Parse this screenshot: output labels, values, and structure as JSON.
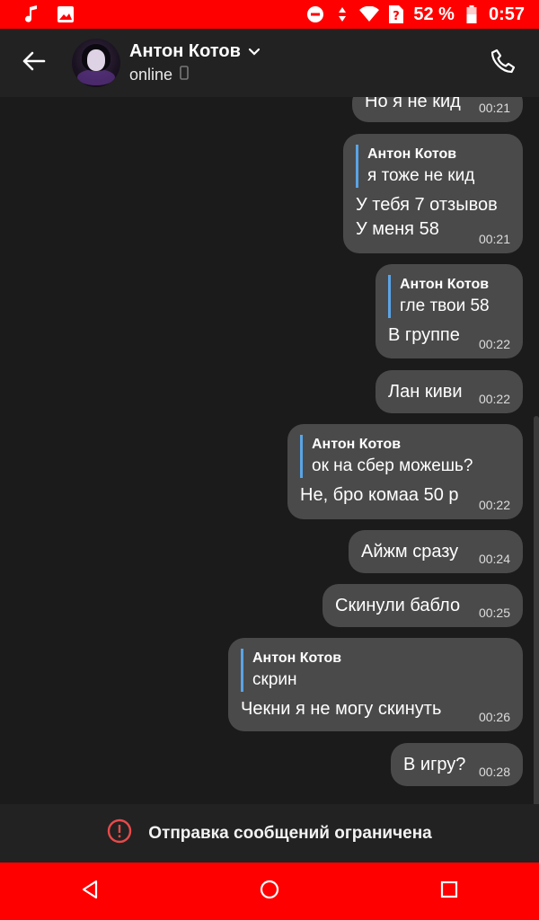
{
  "status_bar": {
    "battery_percent": "52 %",
    "time": "0:57",
    "icons": [
      "music-note-icon",
      "image-icon",
      "do-not-disturb-icon",
      "data-arrows-icon",
      "wifi-icon",
      "sim-unknown-icon",
      "battery-icon"
    ]
  },
  "header": {
    "contact_name": "Антон Котов",
    "contact_status": "online",
    "icons": [
      "back-arrow-icon",
      "avatar",
      "chevron-down-icon",
      "mobile-device-icon",
      "phone-icon"
    ]
  },
  "messages": [
    {
      "text": "Но я не кид",
      "time": "00:21"
    },
    {
      "quote_author": "Антон Котов",
      "quote_text": "я тоже не кид",
      "text1": "У тебя 7 отзывов",
      "text2": "У меня 58",
      "time": "00:21"
    },
    {
      "quote_author": "Антон Котов",
      "quote_text": "гле твои 58",
      "text": "В группе",
      "time": "00:22"
    },
    {
      "text": "Лан киви",
      "time": "00:22"
    },
    {
      "quote_author": "Антон Котов",
      "quote_text": "ок на сбер можешь?",
      "text": "Не, бро комаа 50 р",
      "time": "00:22"
    },
    {
      "text": "Айжм сразу",
      "time": "00:24"
    },
    {
      "text": "Скинули бабло",
      "time": "00:25"
    },
    {
      "quote_author": "Антон Котов",
      "quote_text": "скрин",
      "text": "Чекни я не могу скинуть",
      "time": "00:26"
    },
    {
      "text": "В игру?",
      "time": "00:28"
    }
  ],
  "restricted": {
    "text": "Отправка сообщений ограничена",
    "icon": "exclamation-circle-icon",
    "accent_color": "#e84a4a"
  },
  "nav": {
    "icons": [
      "back-triangle-icon",
      "home-circle-icon",
      "recents-square-icon"
    ]
  },
  "colors": {
    "status_bar": "#ff0000",
    "bubble": "#4a4a4a",
    "quote_bar": "#5aa4e6",
    "background": "#1b1b1b"
  }
}
